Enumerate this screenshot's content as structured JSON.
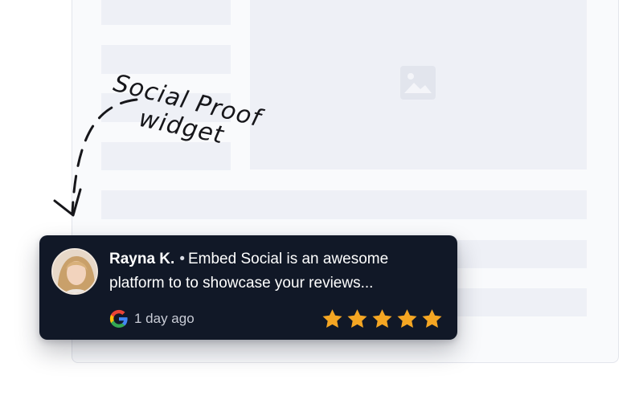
{
  "annotation": {
    "line1": "Social Proof",
    "line2": "widget"
  },
  "review": {
    "reviewer_name": "Rayna K.",
    "separator": "•",
    "text": "Embed Social is an awesome platform to to showcase your reviews...",
    "source_icon": "google-icon",
    "time_ago": "1 day ago",
    "rating": 5,
    "rating_max": 5
  },
  "colors": {
    "widget_bg": "#111827",
    "star": "#f5a623",
    "placeholder": "#eef0f6"
  }
}
